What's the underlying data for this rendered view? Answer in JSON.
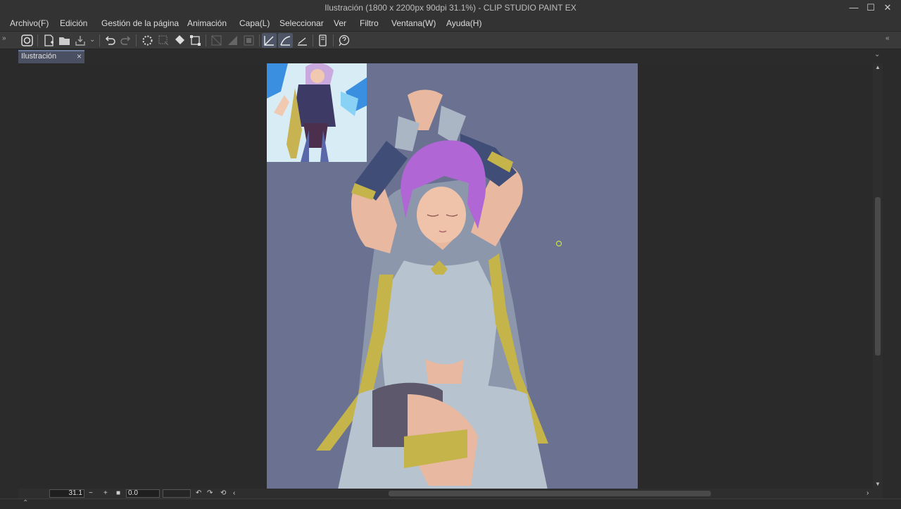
{
  "window": {
    "title": "Ilustración (1800 x 2200px 90dpi 31.1%)  - CLIP STUDIO PAINT EX",
    "minimize": "—",
    "maximize": "☐",
    "close": "✕"
  },
  "menu": [
    {
      "label": "Archivo(F)"
    },
    {
      "label": "Edición"
    },
    {
      "label": "Gestión de la página"
    },
    {
      "label": "Animación"
    },
    {
      "label": "Capa(L)"
    },
    {
      "label": "Seleccionar"
    },
    {
      "label": "Ver"
    },
    {
      "label": "Filtro"
    },
    {
      "label": "Ventana(W)"
    },
    {
      "label": "Ayuda(H)"
    }
  ],
  "toolbar": {
    "icons": [
      "clip-studio-icon",
      "new-file-icon",
      "open-file-icon",
      "export-icon",
      "undo-icon",
      "redo-icon",
      "loading-icon",
      "clear-selection-icon",
      "fill-icon",
      "transform-icon",
      "crop-icon",
      "tone-icon",
      "mask-icon",
      "ruler-snap-icon",
      "special-ruler-snap-icon",
      "grid-snap-icon",
      "device-icon",
      "help-icon"
    ]
  },
  "document_tab": {
    "label": "Ilustración",
    "close": "×"
  },
  "status": {
    "zoom": "31.1",
    "zoom_out": "−",
    "zoom_in": "+",
    "rotation": "0.0"
  },
  "colors": {
    "canvas_bg": "#6a7191",
    "hair": "#b166d6",
    "skin": "#e8b9a0",
    "dress": "#b7c3ce",
    "gold": "#c4b44a",
    "sleeve": "#3f4d77"
  }
}
